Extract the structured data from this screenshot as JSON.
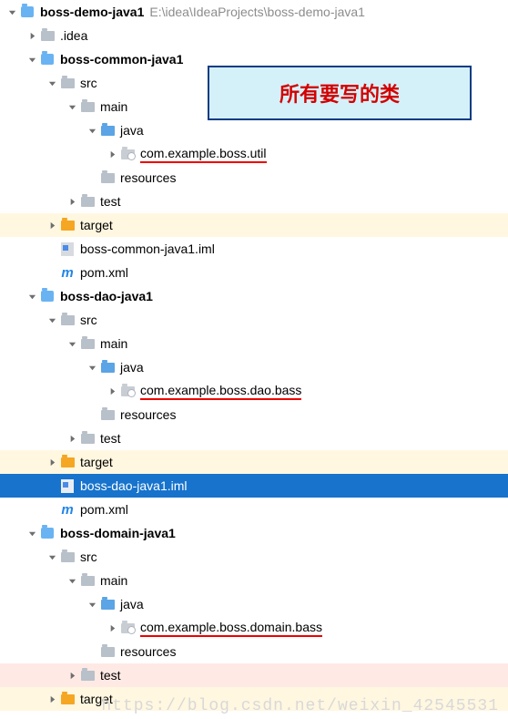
{
  "callout": {
    "text": "所有要写的类"
  },
  "watermark": "https://blog.csdn.net/weixin_42545531",
  "tree": [
    {
      "depth": 0,
      "arrow": "open",
      "icon": "module",
      "bold": true,
      "label": "boss-demo-java1",
      "hint": "E:\\idea\\IdeaProjects\\boss-demo-java1"
    },
    {
      "depth": 1,
      "arrow": "closed",
      "icon": "folder-g",
      "label": ".idea"
    },
    {
      "depth": 1,
      "arrow": "open",
      "icon": "module",
      "bold": true,
      "label": "boss-common-java1"
    },
    {
      "depth": 2,
      "arrow": "open",
      "icon": "folder-g",
      "label": "src"
    },
    {
      "depth": 3,
      "arrow": "open",
      "icon": "folder-g",
      "label": "main"
    },
    {
      "depth": 4,
      "arrow": "open",
      "icon": "folder-b",
      "label": "java"
    },
    {
      "depth": 5,
      "arrow": "closed",
      "icon": "pkg",
      "label": "com.example.boss.util",
      "underline": true
    },
    {
      "depth": 4,
      "arrow": "none",
      "icon": "folder-g",
      "label": "resources"
    },
    {
      "depth": 3,
      "arrow": "closed",
      "icon": "folder-g",
      "label": "test"
    },
    {
      "depth": 2,
      "arrow": "closed",
      "icon": "folder-o",
      "label": "target",
      "hl": "orange"
    },
    {
      "depth": 2,
      "arrow": "none",
      "icon": "iml",
      "label": "boss-common-java1.iml"
    },
    {
      "depth": 2,
      "arrow": "none",
      "icon": "m",
      "label": "pom.xml"
    },
    {
      "depth": 1,
      "arrow": "open",
      "icon": "module",
      "bold": true,
      "label": "boss-dao-java1"
    },
    {
      "depth": 2,
      "arrow": "open",
      "icon": "folder-g",
      "label": "src"
    },
    {
      "depth": 3,
      "arrow": "open",
      "icon": "folder-g",
      "label": "main"
    },
    {
      "depth": 4,
      "arrow": "open",
      "icon": "folder-b",
      "label": "java"
    },
    {
      "depth": 5,
      "arrow": "closed",
      "icon": "pkg",
      "label": "com.example.boss.dao.bass",
      "underline": true
    },
    {
      "depth": 4,
      "arrow": "none",
      "icon": "folder-g",
      "label": "resources"
    },
    {
      "depth": 3,
      "arrow": "closed",
      "icon": "folder-g",
      "label": "test"
    },
    {
      "depth": 2,
      "arrow": "closed",
      "icon": "folder-o",
      "label": "target",
      "hl": "orange"
    },
    {
      "depth": 2,
      "arrow": "none",
      "icon": "iml",
      "label": "boss-dao-java1.iml",
      "sel": true
    },
    {
      "depth": 2,
      "arrow": "none",
      "icon": "m",
      "label": "pom.xml"
    },
    {
      "depth": 1,
      "arrow": "open",
      "icon": "module",
      "bold": true,
      "label": "boss-domain-java1"
    },
    {
      "depth": 2,
      "arrow": "open",
      "icon": "folder-g",
      "label": "src"
    },
    {
      "depth": 3,
      "arrow": "open",
      "icon": "folder-g",
      "label": "main"
    },
    {
      "depth": 4,
      "arrow": "open",
      "icon": "folder-b",
      "label": "java"
    },
    {
      "depth": 5,
      "arrow": "closed",
      "icon": "pkg",
      "label": "com.example.boss.domain.bass",
      "underline": true
    },
    {
      "depth": 4,
      "arrow": "none",
      "icon": "folder-g",
      "label": "resources"
    },
    {
      "depth": 3,
      "arrow": "closed",
      "icon": "folder-g",
      "label": "test",
      "hl": "red"
    },
    {
      "depth": 2,
      "arrow": "closed",
      "icon": "folder-o",
      "label": "target",
      "hl": "orange"
    }
  ]
}
